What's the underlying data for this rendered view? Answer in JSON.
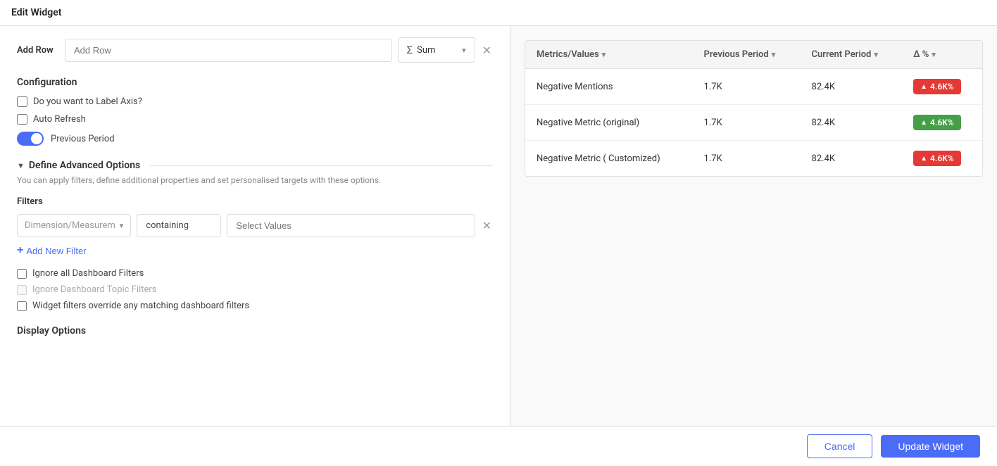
{
  "page": {
    "title": "Edit Widget"
  },
  "add_row": {
    "label": "Add Row",
    "placeholder": "Add Row",
    "sum_label": "Sum"
  },
  "configuration": {
    "title": "Configuration",
    "label_axis": "Do you want to Label Axis?",
    "auto_refresh": "Auto Refresh",
    "previous_period": "Previous Period"
  },
  "advanced": {
    "title": "Define Advanced Options",
    "description": "You can apply filters, define additional properties and set personalised targets with these options."
  },
  "filters": {
    "title": "Filters",
    "dimension_placeholder": "Dimension/Measurem",
    "containing_value": "containing",
    "values_placeholder": "Select Values",
    "add_filter_label": "Add New Filter",
    "ignore_dashboard": "Ignore all Dashboard Filters",
    "ignore_topic": "Ignore Dashboard Topic Filters",
    "widget_override": "Widget filters override any matching dashboard filters"
  },
  "display_options": {
    "title": "Display Options"
  },
  "table": {
    "columns": [
      {
        "label": "Metrics/Values"
      },
      {
        "label": "Previous Period"
      },
      {
        "label": "Current Period"
      },
      {
        "label": "Δ %"
      }
    ],
    "rows": [
      {
        "metric": "Negative Mentions",
        "previous": "1.7K",
        "current": "82.4K",
        "delta": "4.6K%",
        "delta_type": "red"
      },
      {
        "metric": "Negative Metric (original)",
        "previous": "1.7K",
        "current": "82.4K",
        "delta": "4.6K%",
        "delta_type": "green"
      },
      {
        "metric": "Negative Metric ( Customized)",
        "previous": "1.7K",
        "current": "82.4K",
        "delta": "4.6K%",
        "delta_type": "red"
      }
    ]
  },
  "footer": {
    "cancel_label": "Cancel",
    "update_label": "Update Widget"
  }
}
